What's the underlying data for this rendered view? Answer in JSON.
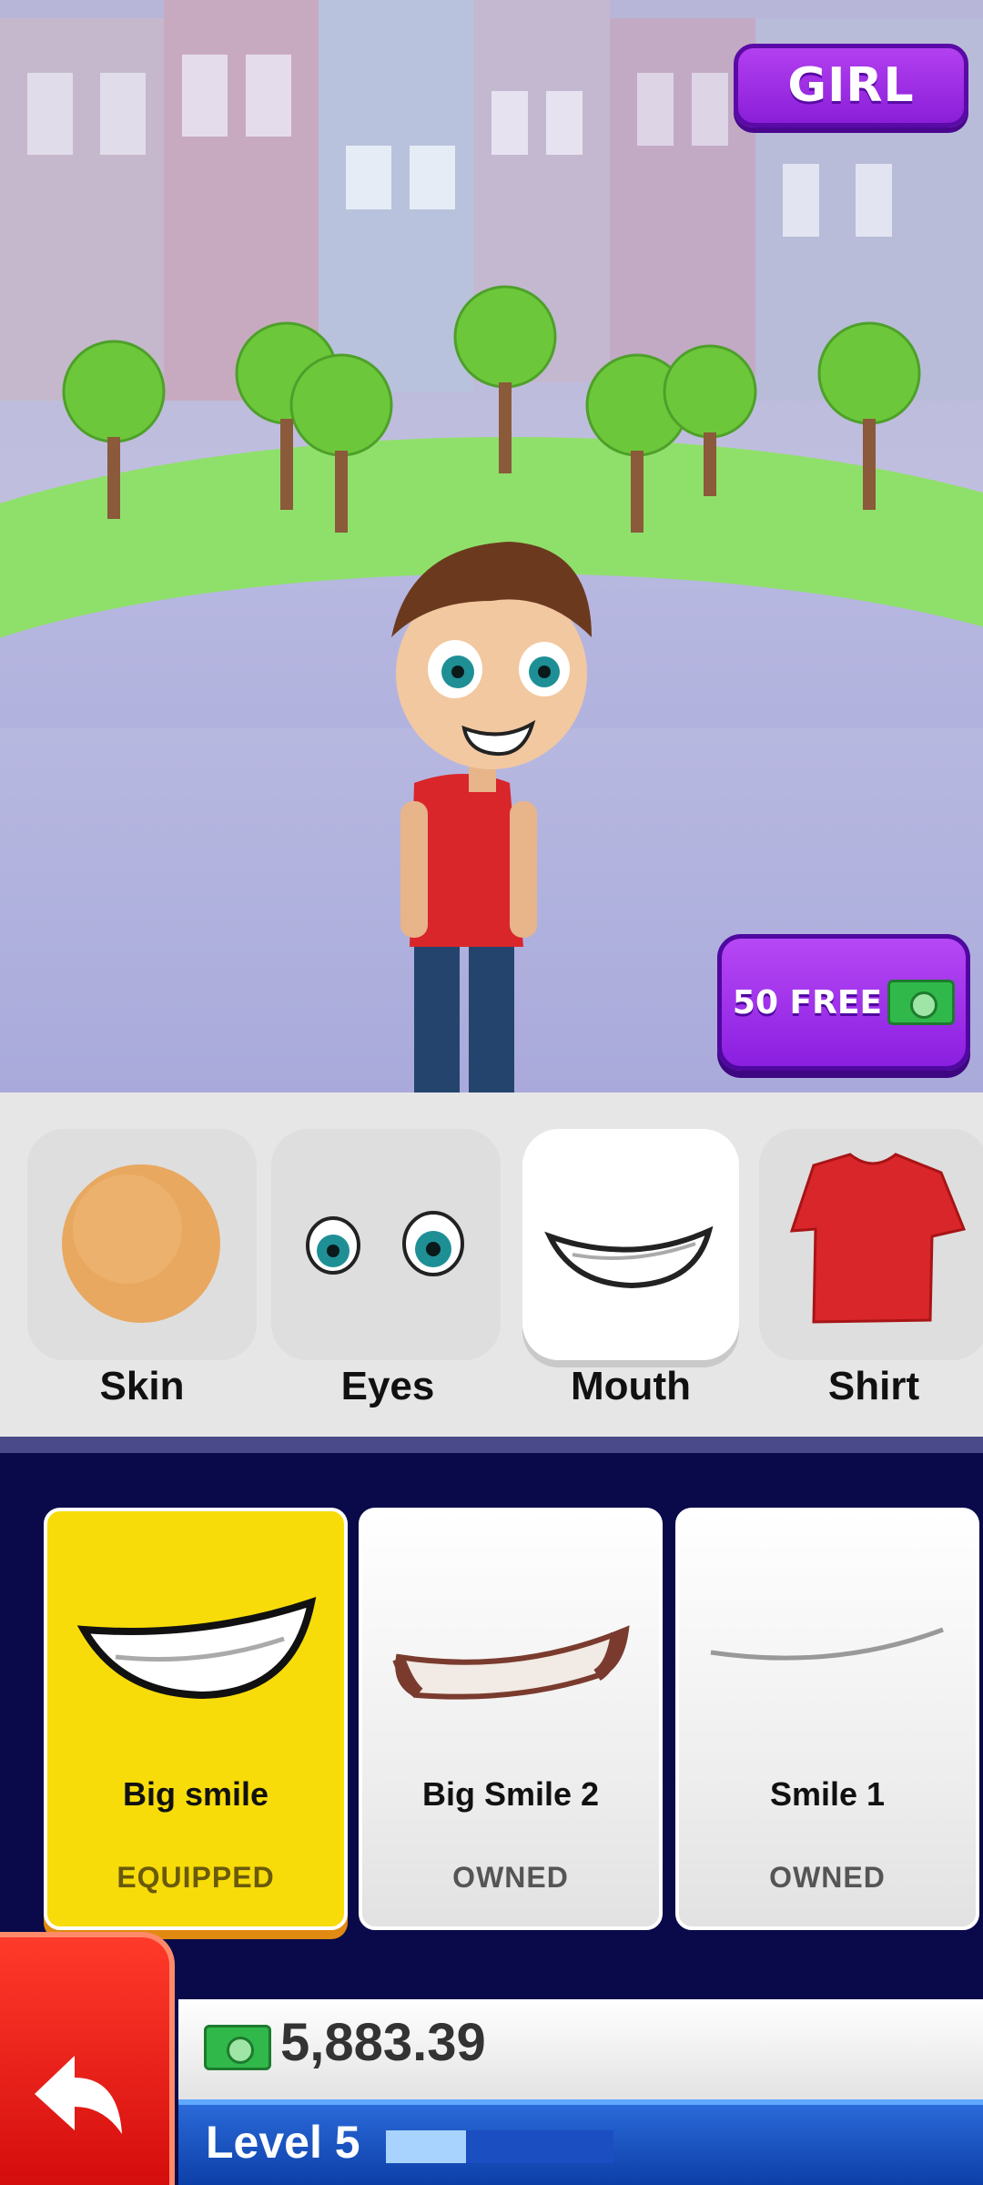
{
  "top_button": {
    "label": "GIRL"
  },
  "offer_button": {
    "label": "50 FREE",
    "icon": "cash-icon"
  },
  "tabs": [
    {
      "label": "Skin",
      "icon": "skin-swatch-icon"
    },
    {
      "label": "Eyes",
      "icon": "eyes-icon"
    },
    {
      "label": "Mouth",
      "icon": "mouth-icon",
      "active": true
    },
    {
      "label": "Shirt",
      "icon": "shirt-icon"
    }
  ],
  "items": [
    {
      "name": "Big smile",
      "status": "EQUIPPED"
    },
    {
      "name": "Big Smile 2",
      "status": "OWNED"
    },
    {
      "name": "Smile 1",
      "status": "OWNED"
    }
  ],
  "hud": {
    "cash": "5,883.39",
    "level_label": "Level 5",
    "level_progress": 0.35
  },
  "colors": {
    "accent_purple": "#9a2ee6",
    "equipped_yellow": "#f7dc0a",
    "back_red": "#e01a12",
    "level_blue": "#1a4fc0"
  }
}
